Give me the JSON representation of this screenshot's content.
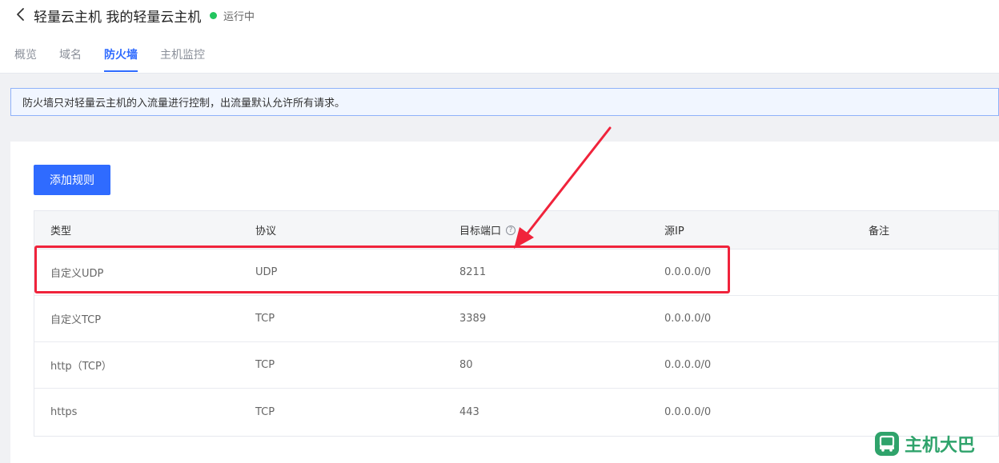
{
  "header": {
    "title": "轻量云主机 我的轻量云主机",
    "status": "运行中",
    "tabs": [
      {
        "label": "概览",
        "active": false
      },
      {
        "label": "域名",
        "active": false
      },
      {
        "label": "防火墙",
        "active": true
      },
      {
        "label": "主机监控",
        "active": false
      }
    ]
  },
  "banner": {
    "text": "防火墙只对轻量云主机的入流量进行控制，出流量默认允许所有请求。"
  },
  "toolbar": {
    "add_rule_label": "添加规则"
  },
  "table": {
    "columns": [
      "类型",
      "协议",
      "目标端口",
      "源IP",
      "备注"
    ],
    "rows": [
      {
        "type": "自定义UDP",
        "protocol": "UDP",
        "port": "8211",
        "source": "0.0.0.0/0",
        "remark": ""
      },
      {
        "type": "自定义TCP",
        "protocol": "TCP",
        "port": "3389",
        "source": "0.0.0.0/0",
        "remark": ""
      },
      {
        "type": "http（TCP）",
        "protocol": "TCP",
        "port": "80",
        "source": "0.0.0.0/0",
        "remark": ""
      },
      {
        "type": "https",
        "protocol": "TCP",
        "port": "443",
        "source": "0.0.0.0/0",
        "remark": ""
      }
    ]
  },
  "logo": {
    "text": "主机大巴"
  },
  "colors": {
    "accent": "#2f6bff",
    "status_green": "#22c55e",
    "annotation_red": "#f0233b",
    "logo_green": "#2fa36b"
  },
  "icons": {
    "back": "chevron-left-icon",
    "help": "question-circle-icon",
    "logo": "bus-icon"
  }
}
